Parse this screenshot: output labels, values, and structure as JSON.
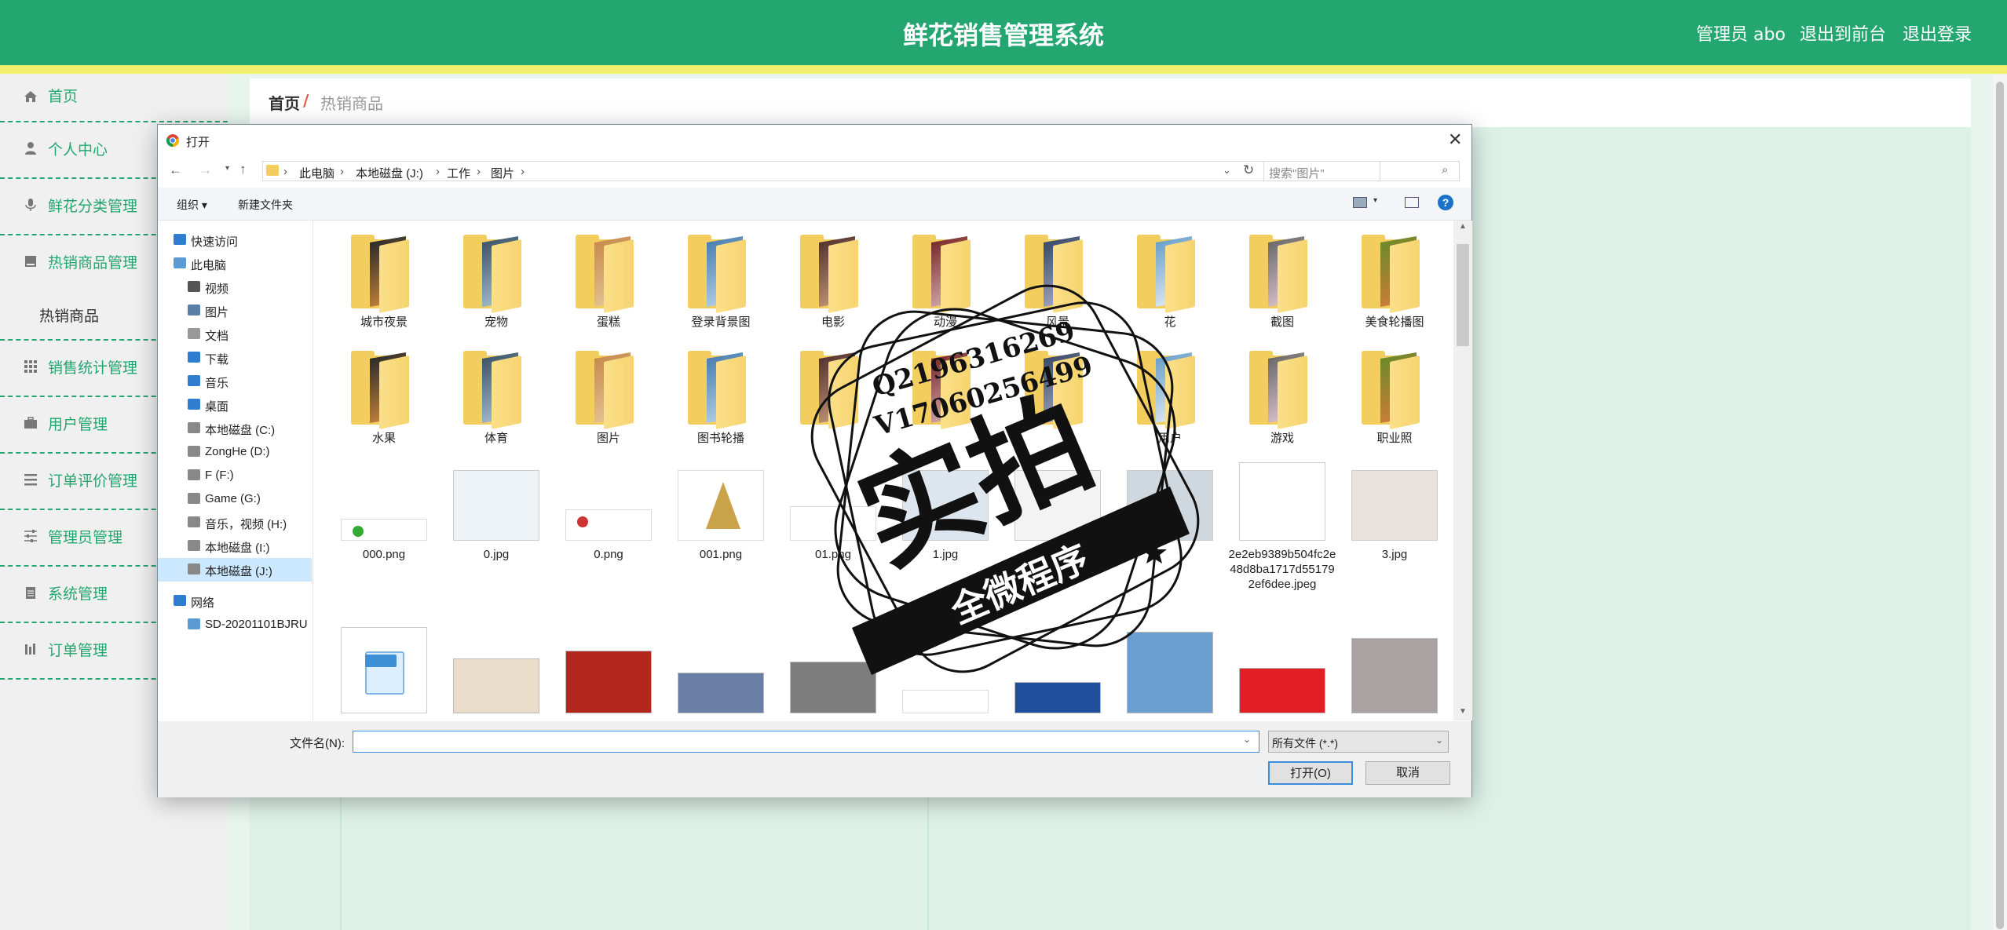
{
  "app": {
    "title": "鲜花销售管理系统",
    "nav": [
      "管理员 abo",
      "退出到前台",
      "退出登录"
    ]
  },
  "sidebar": {
    "items": [
      {
        "label": "首页",
        "icon": "home-icon"
      },
      {
        "label": "个人中心",
        "icon": "user-icon"
      },
      {
        "label": "鲜花分类管理",
        "icon": "microphone-icon"
      },
      {
        "label": "热销商品管理",
        "icon": "book-icon"
      },
      {
        "label": "销售统计管理",
        "icon": "grid-icon"
      },
      {
        "label": "用户管理",
        "icon": "briefcase-icon"
      },
      {
        "label": "订单评价管理",
        "icon": "list-icon"
      },
      {
        "label": "管理员管理",
        "icon": "sliders-icon"
      },
      {
        "label": "系统管理",
        "icon": "clipboard-icon"
      },
      {
        "label": "订单管理",
        "icon": "chart-icon"
      }
    ],
    "subitem": "热销商品"
  },
  "breadcrumb": {
    "home": "首页",
    "sep": "/",
    "current": "热销商品"
  },
  "dialog": {
    "title": "打开",
    "address": [
      "此电脑",
      "本地磁盘 (J:)",
      "工作",
      "图片"
    ],
    "search_placeholder": "搜索\"图片\"",
    "toolbar": {
      "organize": "组织 ▾",
      "new_folder": "新建文件夹"
    },
    "nav": [
      {
        "label": "快速访问",
        "icon": "star-icon",
        "color": "#2e7dd1"
      },
      {
        "label": "此电脑",
        "icon": "computer-icon",
        "color": "#5a9bd6"
      },
      {
        "label": "视频",
        "icon": "video-icon",
        "color": "#555555"
      },
      {
        "label": "图片",
        "icon": "pictures-icon",
        "color": "#5a7fa6"
      },
      {
        "label": "文档",
        "icon": "document-icon",
        "color": "#999999"
      },
      {
        "label": "下载",
        "icon": "download-icon",
        "color": "#2e7dd1"
      },
      {
        "label": "音乐",
        "icon": "music-icon",
        "color": "#2e7dd1"
      },
      {
        "label": "桌面",
        "icon": "desktop-icon",
        "color": "#2e7dd1"
      },
      {
        "label": "本地磁盘 (C:)",
        "icon": "drive-icon",
        "color": "#888888"
      },
      {
        "label": "ZongHe (D:)",
        "icon": "drive-icon",
        "color": "#888888"
      },
      {
        "label": "F (F:)",
        "icon": "drive-icon",
        "color": "#888888"
      },
      {
        "label": "Game (G:)",
        "icon": "drive-icon",
        "color": "#888888"
      },
      {
        "label": "音乐，视频 (H:)",
        "icon": "drive-icon",
        "color": "#888888"
      },
      {
        "label": "本地磁盘 (I:)",
        "icon": "drive-icon",
        "color": "#888888"
      },
      {
        "label": "本地磁盘 (J:)",
        "icon": "drive-icon",
        "color": "#888888",
        "selected": true
      },
      {
        "label": "网络",
        "icon": "network-icon",
        "color": "#2e7dd1"
      },
      {
        "label": "SD-20201101BJRU",
        "icon": "computer-icon",
        "color": "#5a9bd6"
      }
    ],
    "folders_row1": [
      "城市夜景",
      "宠物",
      "蛋糕",
      "登录背景图",
      "电影",
      "动漫",
      "风景",
      "花",
      "截图",
      "美食轮播图"
    ],
    "folders_row2": [
      "水果",
      "体育",
      "图片",
      "图书轮播",
      "",
      "",
      "",
      "用户",
      "游戏",
      "职业照"
    ],
    "files_row3": [
      "000.png",
      "0.jpg",
      "0.png",
      "001.png",
      "01.png",
      "1.jpg",
      "",
      "",
      "2e2eb9389b504fc2e48d8ba1717d551792ef6dee.jpeg",
      "3.jpg"
    ],
    "filename_label": "文件名(N):",
    "filename_value": "",
    "filetype": "所有文件 (*.*)",
    "open_label": "打开(O)",
    "cancel_label": "取消"
  },
  "watermark": {
    "qq": "Q2196316269",
    "wx": "V17060256499",
    "main": "实拍",
    "banner": "全微程序"
  }
}
